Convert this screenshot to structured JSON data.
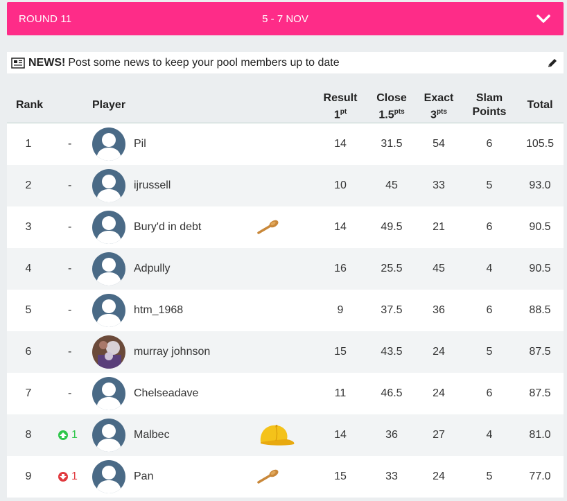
{
  "round": {
    "label": "ROUND 11",
    "dates": "5 - 7 NOV",
    "bg_color": "#fe2c88"
  },
  "news": {
    "icon": "newspaper-icon",
    "title": "NEWS!",
    "text": "Post some news to keep your pool members up to date",
    "edit_icon": "pencil-icon"
  },
  "table": {
    "headers": {
      "rank": "Rank",
      "player": "Player",
      "result": "Result",
      "result_pts": "1",
      "result_sup": "pt",
      "close": "Close",
      "close_pts": "1.5",
      "close_sup": "pts",
      "exact": "Exact",
      "exact_pts": "3",
      "exact_sup": "pts",
      "slam_line1": "Slam",
      "slam_line2": "Points",
      "total": "Total"
    },
    "rows": [
      {
        "rank": "1",
        "move": "-",
        "move_dir": "none",
        "name": "Pil",
        "avatar": "default",
        "badge": "",
        "result": "14",
        "close": "31.5",
        "exact": "54",
        "slam": "6",
        "total": "105.5"
      },
      {
        "rank": "2",
        "move": "-",
        "move_dir": "none",
        "name": "ijrussell",
        "avatar": "default",
        "badge": "",
        "result": "10",
        "close": "45",
        "exact": "33",
        "slam": "5",
        "total": "93.0"
      },
      {
        "rank": "3",
        "move": "-",
        "move_dir": "none",
        "name": "Bury'd in debt",
        "avatar": "default",
        "badge": "wooden-spoon-icon",
        "result": "14",
        "close": "49.5",
        "exact": "21",
        "slam": "6",
        "total": "90.5"
      },
      {
        "rank": "4",
        "move": "-",
        "move_dir": "none",
        "name": "Adpully",
        "avatar": "default",
        "badge": "",
        "result": "16",
        "close": "25.5",
        "exact": "45",
        "slam": "4",
        "total": "90.5"
      },
      {
        "rank": "5",
        "move": "-",
        "move_dir": "none",
        "name": "htm_1968",
        "avatar": "default",
        "badge": "",
        "result": "9",
        "close": "37.5",
        "exact": "36",
        "slam": "6",
        "total": "88.5"
      },
      {
        "rank": "6",
        "move": "-",
        "move_dir": "none",
        "name": "murray johnson",
        "avatar": "photo",
        "badge": "",
        "result": "15",
        "close": "43.5",
        "exact": "24",
        "slam": "5",
        "total": "87.5"
      },
      {
        "rank": "7",
        "move": "-",
        "move_dir": "none",
        "name": "Chelseadave",
        "avatar": "default",
        "badge": "",
        "result": "11",
        "close": "46.5",
        "exact": "24",
        "slam": "6",
        "total": "87.5"
      },
      {
        "rank": "8",
        "move": "1",
        "move_dir": "up",
        "name": "Malbec",
        "avatar": "default",
        "badge": "yellow-cap-icon",
        "result": "14",
        "close": "36",
        "exact": "27",
        "slam": "4",
        "total": "81.0"
      },
      {
        "rank": "9",
        "move": "1",
        "move_dir": "down",
        "name": "Pan",
        "avatar": "default",
        "badge": "wooden-spoon-icon",
        "result": "15",
        "close": "33",
        "exact": "24",
        "slam": "5",
        "total": "77.0"
      }
    ]
  },
  "colors": {
    "up": "#2ec64a",
    "down": "#e0393e",
    "avatar_bg": "#4a6a86"
  }
}
